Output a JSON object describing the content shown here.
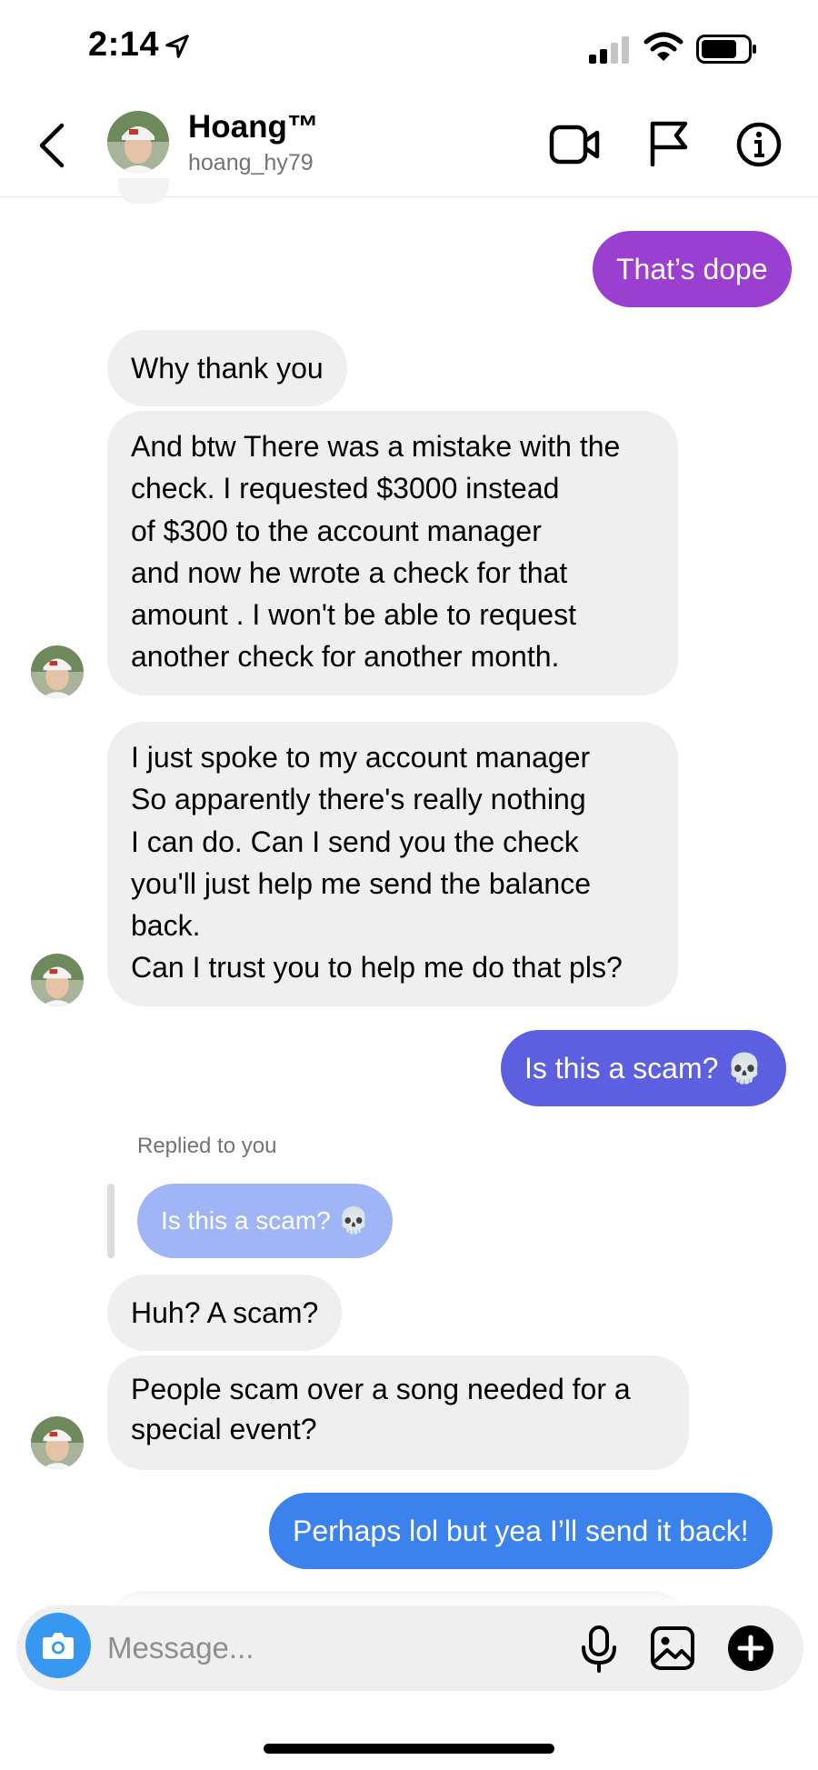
{
  "status_bar": {
    "time": "2:14"
  },
  "header": {
    "name": "Hoang™",
    "username": "hoang_hy79"
  },
  "messages": [
    {
      "text": "That’s dope"
    },
    {
      "text": "Why thank you"
    },
    {
      "lines": [
        "And btw There was a mistake with the",
        "check. I requested $3000 instead",
        "of $300 to the account manager",
        "and now he wrote a check for that",
        "amount . I won't be able to request",
        "another check for another month."
      ]
    },
    {
      "lines": [
        "I just spoke to my account manager",
        "So apparently there's really nothing",
        "I can do. Can I send you the check",
        "you'll just help me send the balance",
        "back.",
        "Can I trust you to help me do that pls?"
      ]
    },
    {
      "text": "Is this a scam? 💀"
    },
    {
      "reply_label": "Replied to you",
      "quoted": "Is this a scam? 💀"
    },
    {
      "text": "Huh? A scam?"
    },
    {
      "lines": [
        "People scam over a song needed for a",
        "special event?"
      ]
    },
    {
      "text": "Perhaps lol but yea I’ll send it back!"
    }
  ],
  "composer": {
    "placeholder": "Message..."
  },
  "colors": {
    "out_purple": "#9b3fd0",
    "out_indigo": "#5b5fe0",
    "out_blue": "#3b82ec",
    "incoming": "#efefef",
    "camera": "#3897f0"
  },
  "icons": [
    "location-arrow-icon",
    "signal-icon",
    "wifi-icon",
    "battery-icon",
    "back-icon",
    "video-call-icon",
    "flag-icon",
    "info-icon",
    "camera-icon",
    "mic-icon",
    "gallery-icon",
    "plus-icon"
  ]
}
